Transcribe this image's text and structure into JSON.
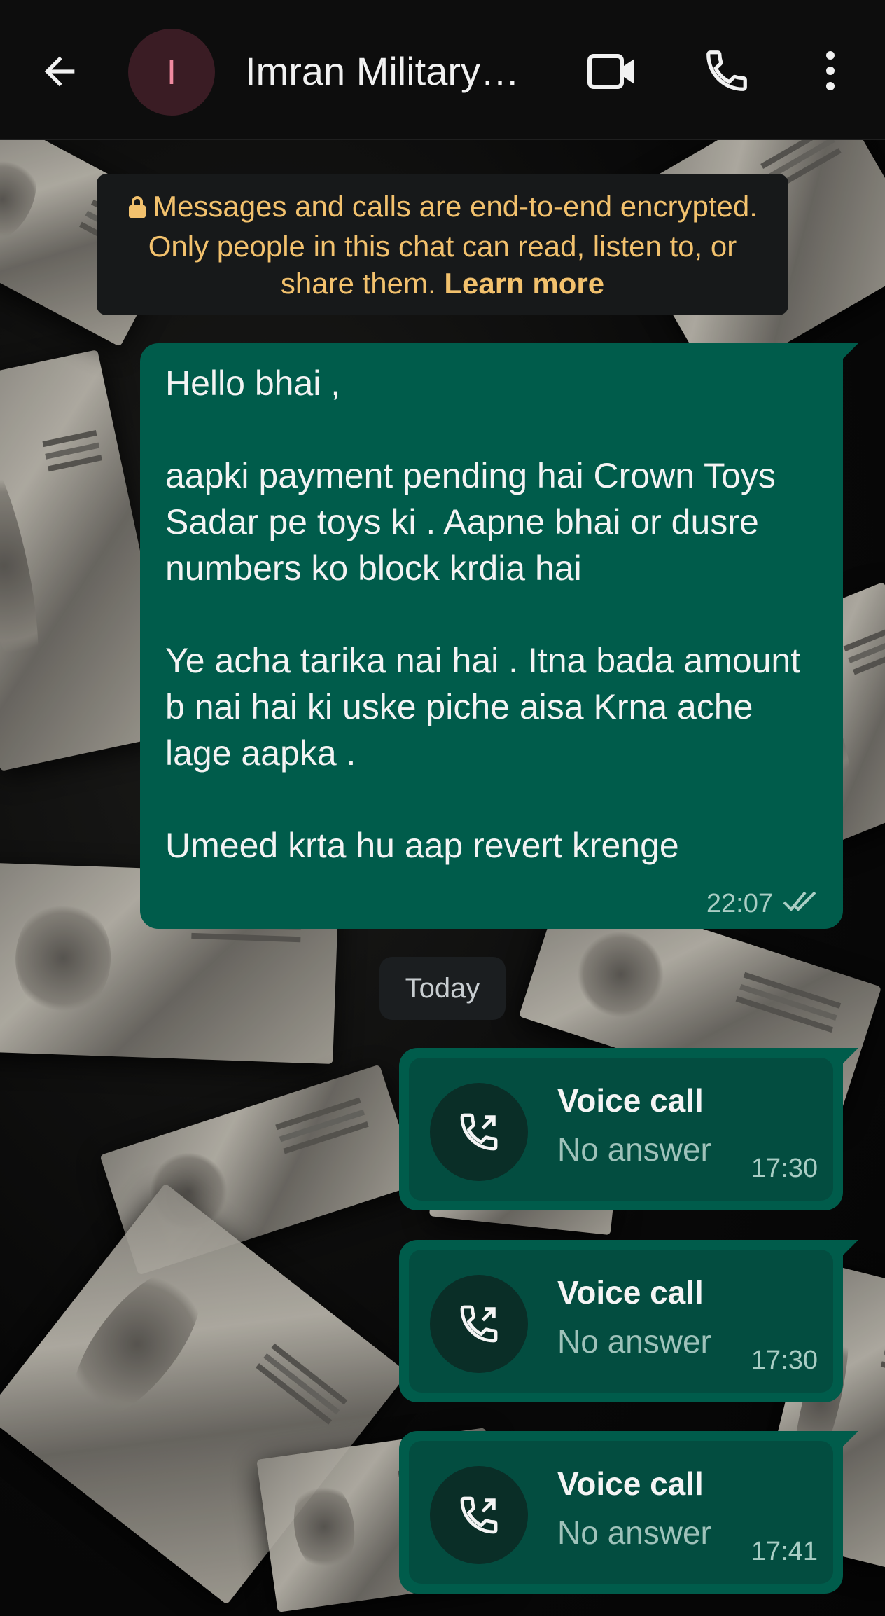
{
  "header": {
    "avatar_initial": "I",
    "contact_name": "Imran Military…"
  },
  "encryption_notice": {
    "text": "Messages and calls are end-to-end encrypted. Only people in this chat can read, listen to, or share them. ",
    "link": "Learn more"
  },
  "message": {
    "text": "Hello bhai ,\n\naapki payment pending hai Crown Toys Sadar pe toys ki . Aapne bhai or dusre numbers ko block krdia hai\n\nYe acha tarika nai hai . Itna bada amount b nai hai ki uske piche aisa Krna ache lage aapka .\n\nUmeed krta hu aap revert krenge",
    "time": "22:07",
    "status_icon": "double-check-icon"
  },
  "date_separator": "Today",
  "calls": [
    {
      "title": "Voice call",
      "status": "No answer",
      "time": "17:30"
    },
    {
      "title": "Voice call",
      "status": "No answer",
      "time": "17:30"
    },
    {
      "title": "Voice call",
      "status": "No answer",
      "time": "17:41"
    }
  ],
  "colors": {
    "bubble_outgoing": "#005c4b",
    "notice_text": "#f2c16d",
    "appbar_bg": "#0d0d0d"
  }
}
